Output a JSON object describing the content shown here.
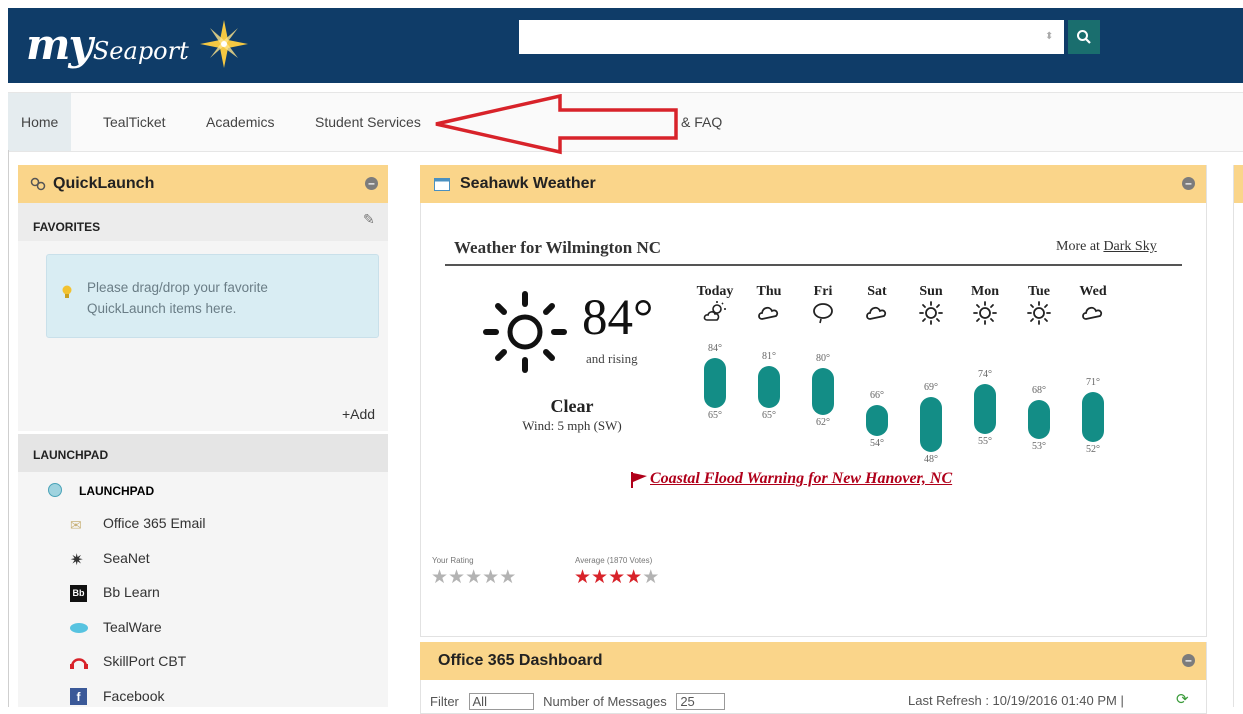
{
  "header": {
    "logo_my": "my",
    "logo_seaport": "Seaport",
    "search_placeholder": ""
  },
  "nav": {
    "items": [
      {
        "label": "Home",
        "active": true
      },
      {
        "label": "TealTicket"
      },
      {
        "label": "Academics"
      },
      {
        "label": "Student Services"
      },
      {
        "label": "& FAQ"
      }
    ]
  },
  "quicklaunch": {
    "title": "QuickLaunch",
    "favorites_label": "FAVORITES",
    "favorites_hint": "Please drag/drop your favorite QuickLaunch items here.",
    "add_label": "+Add",
    "launchpad_section": "LAUNCHPAD",
    "launchpad_group": "LAUNCHPAD",
    "launchpad_items": [
      "Office 365 Email",
      "SeaNet",
      "Bb Learn",
      "TealWare",
      "SkillPort CBT",
      "Facebook"
    ]
  },
  "weather": {
    "panel_title": "Seahawk Weather",
    "location_title": "Weather for Wilmington NC",
    "more_prefix": "More at",
    "more_link": "Dark Sky",
    "current_temp": "84°",
    "trend": "and rising",
    "condition": "Clear",
    "wind": "Wind: 5 mph (SW)",
    "warning": "Coastal Flood Warning for New Hanover, NC",
    "forecast": [
      {
        "day": "Today",
        "high": "84°",
        "low": "65°",
        "icon": "partly-sunny-icon"
      },
      {
        "day": "Thu",
        "high": "81°",
        "low": "65°",
        "icon": "cloudy-icon"
      },
      {
        "day": "Fri",
        "high": "80°",
        "low": "62°",
        "icon": "rain-icon"
      },
      {
        "day": "Sat",
        "high": "66°",
        "low": "54°",
        "icon": "cloudy-icon"
      },
      {
        "day": "Sun",
        "high": "69°",
        "low": "48°",
        "icon": "sun-icon"
      },
      {
        "day": "Mon",
        "high": "74°",
        "low": "55°",
        "icon": "sun-icon"
      },
      {
        "day": "Tue",
        "high": "68°",
        "low": "53°",
        "icon": "sun-icon"
      },
      {
        "day": "Wed",
        "high": "71°",
        "low": "52°",
        "icon": "cloudy-icon"
      }
    ],
    "your_rating_label": "Your Rating",
    "your_rating": 0,
    "average_label": "Average (1870 Votes)",
    "average_rating": 4
  },
  "office365": {
    "title": "Office 365 Dashboard",
    "filter_label": "Filter",
    "filter_value": "All",
    "messages_label": "Number of Messages",
    "messages_value": "25",
    "last_refresh": "Last Refresh : 10/19/2016 01:40 PM |"
  },
  "colors": {
    "header_bg": "#0f3c68",
    "panel_header": "#fad58a",
    "accent_teal": "#138d86",
    "warning_red": "#b0001a"
  }
}
